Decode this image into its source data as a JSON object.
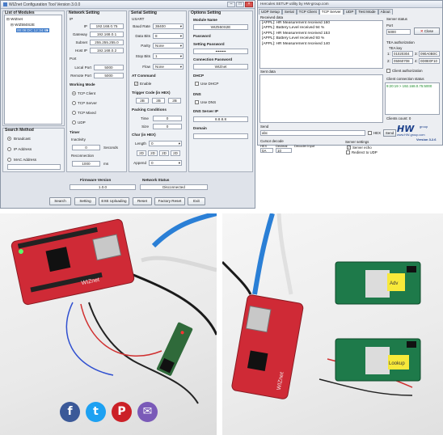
{
  "wiz": {
    "title": "WIZnet Configuration Tool Version 3.0.0",
    "modules_group": "List of Modules",
    "tree_root": "WIZnet",
    "tree_device": "WIZ550S2E",
    "tree_mac": "00:08:DC:12:34:69",
    "search_method": {
      "label": "Search Method",
      "options": [
        "Broadcast",
        "IP Address",
        "MAC Address"
      ]
    },
    "network": {
      "label": "Network Setting",
      "ip_hdr": "IP",
      "ip_label": "IP",
      "ip": "192.168.0.75",
      "gw_label": "Gateway",
      "gw": "192.168.0.1",
      "subnet_label": "Subnet",
      "subnet": "255.255.255.0",
      "hostip_label": "Host IP",
      "hostip": "192.168.0.2",
      "port_hdr": "Port",
      "local_label": "Local Port",
      "local": "5000",
      "remote_label": "Remote Port",
      "remote": "5000",
      "wm_hdr": "Working Mode",
      "modes": [
        "TCP Client",
        "TCP Server",
        "TCP Mixed",
        "UDP"
      ],
      "timer_hdr": "Timer",
      "inact_label": "Inactivity",
      "inact": "0",
      "inact_unit": "Seconds",
      "recon_label": "Reconnection",
      "recon": "1000",
      "recon_unit": "ms"
    },
    "serial": {
      "label": "Serial Setting",
      "usart": "USART",
      "baud_label": "Baud Rate",
      "baud": "38400",
      "data_label": "Data Bits",
      "data": "8",
      "parity_label": "Parity",
      "parity": "None",
      "stop_label": "Stop Bits",
      "stop": "1",
      "flow_label": "Flow",
      "flow": "None",
      "at_hdr": "AT Command",
      "enable_label": "Enable",
      "trig_hdr": "Trigger Code (in HEX)",
      "trig": [
        "2B",
        "2B",
        "2B"
      ],
      "pack_hdr": "Packing Conditions",
      "time_label": "Time",
      "time": "0",
      "size_label": "Size",
      "size": "0",
      "char_hdr": "Char (in HEX)",
      "len_label": "Length",
      "len": "0",
      "chars": [
        "2D",
        "2D",
        "2D",
        "2D"
      ],
      "append_label": "Append",
      "append": "0"
    },
    "options": {
      "label": "Options Setting",
      "mod_hdr": "Module Name",
      "mod": "WIZ550S2E",
      "pw_hdr": "Password",
      "spw_hdr": "Setting Password",
      "spw": "••••••••",
      "cpw_hdr": "Connection Password",
      "cpw": "WIZnet",
      "dhcp_hdr": "DHCP",
      "dhcp_label": "Use DHCP",
      "dns_hdr": "DNS",
      "dns_label": "Use DNS",
      "dnsip_hdr": "DNS Server IP",
      "dnsip": "8.8.8.8",
      "domain_hdr": "Domain"
    },
    "fw_label": "Firmware Version",
    "fw": "1.0.0",
    "ns_label": "Network Status",
    "ns": "Disconnected",
    "buttons": [
      "Search",
      "Setting",
      "EXE Uploading",
      "Reset",
      "Factory Reset",
      "Exit"
    ]
  },
  "herc": {
    "title": "Hercules SETUP utility by HW-group.com",
    "tabs": [
      "UDP Setup",
      "Serial",
      "TCP Client",
      "TCP Server",
      "UDP",
      "Test Mode",
      "About"
    ],
    "active_tab": 3,
    "received_label": "Received data",
    "received": [
      "[APPL]: HR Measurement received 160",
      "[APPL]: Battery Level received 94 %",
      "[APPL]: HR Measurement received 153",
      "[APPL]: Battery Level received 93 %",
      "[APPL]: HR Measurement received 140"
    ],
    "sent_label": "Sent data",
    "server_status_label": "Server status",
    "port_label": "Port",
    "port": "5000",
    "close_label": "Close",
    "tea_label": "TEA authorization",
    "tea_key_label": "TEA key",
    "tea_keys": [
      {
        "n": "1:",
        "a": "01020304",
        "b": "3:",
        "c": "090A0B0C"
      },
      {
        "n": "2:",
        "a": "05060708",
        "b": "4:",
        "c": "0D0E0F10"
      }
    ],
    "client_auth": "Client authorization",
    "conn_status_label": "Client connection status",
    "conn_entry": "9:20:19 > 192.168.0.75:5000",
    "clients_label": "Clients count: 0",
    "send_label": "Send",
    "send_value": "abc",
    "hex_label": "HEX",
    "send_btn": "Send",
    "cursor_label": "Cursor decode",
    "dec_hdrs": [
      "HEX",
      "Decimal",
      "Decoder Input"
    ],
    "dec_vals": [
      "0A",
      "10"
    ],
    "server_settings": "Server settings",
    "server_echo": "Server echo",
    "redirect": "Redirect to UDP",
    "logo_text": "HW",
    "logo_group": "group",
    "logo_url": "www.HW-group.com",
    "logo_ver": "Version 3.2.6"
  },
  "photo1": {
    "stamp_text": "WIZnet"
  },
  "photo2": {
    "stamp_text": "WIZnet",
    "label_a": "Adv",
    "label_b": "Lookup"
  },
  "social": [
    {
      "icon": "facebook-icon",
      "glyph": "f",
      "color": "#3b5998"
    },
    {
      "icon": "twitter-icon",
      "glyph": "t",
      "color": "#1da1f2"
    },
    {
      "icon": "pinterest-icon",
      "glyph": "P",
      "color": "#cb2027"
    },
    {
      "icon": "email-icon",
      "glyph": "✉",
      "color": "#7a5ab8"
    }
  ]
}
